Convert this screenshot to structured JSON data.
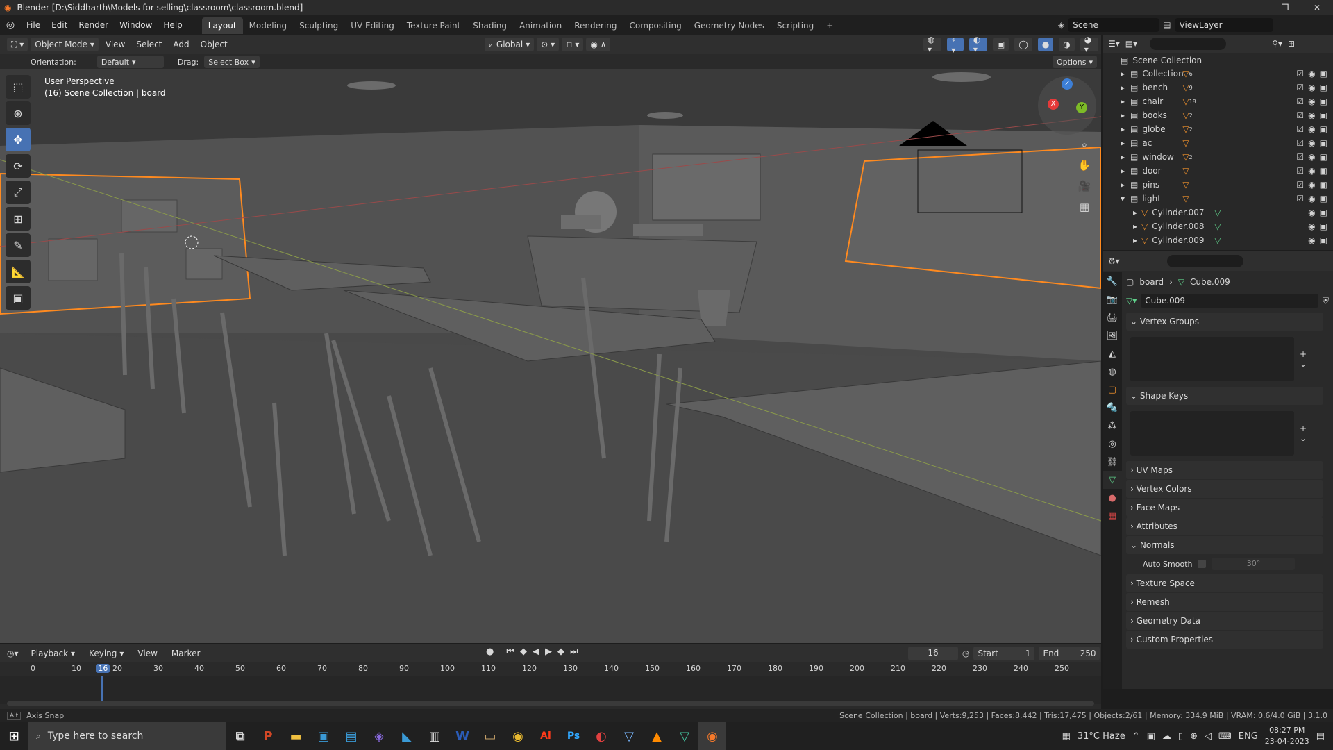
{
  "window": {
    "title": "Blender [D:\\Siddharth\\Models for selling\\classroom\\classroom.blend]",
    "min": "—",
    "restore": "❐",
    "close": "✕"
  },
  "menus": [
    "File",
    "Edit",
    "Render",
    "Window",
    "Help"
  ],
  "workspaces": [
    "Layout",
    "Modeling",
    "Sculpting",
    "UV Editing",
    "Texture Paint",
    "Shading",
    "Animation",
    "Rendering",
    "Compositing",
    "Geometry Nodes",
    "Scripting",
    "+"
  ],
  "scene": {
    "name": "Scene",
    "view_layer": "ViewLayer"
  },
  "header": {
    "mode": "Object Mode",
    "view": "View",
    "select": "Select",
    "add": "Add",
    "object": "Object",
    "transform": "Global"
  },
  "subheader": {
    "orientation_label": "Orientation:",
    "orientation": "Default",
    "drag_label": "Drag:",
    "drag": "Select Box",
    "options": "Options"
  },
  "viewport": {
    "perspective": "User Perspective",
    "collection_info": "(16) Scene Collection | board"
  },
  "outliner": {
    "root": "Scene Collection",
    "items": [
      {
        "label": "Collection",
        "count": "6",
        "expanded": false
      },
      {
        "label": "bench",
        "count": "9",
        "expanded": false
      },
      {
        "label": "chair",
        "count": "18",
        "expanded": false
      },
      {
        "label": "books",
        "count": "2",
        "expanded": false
      },
      {
        "label": "globe",
        "count": "2",
        "expanded": false
      },
      {
        "label": "ac",
        "count": "",
        "expanded": false
      },
      {
        "label": "window",
        "count": "2",
        "expanded": false
      },
      {
        "label": "door",
        "count": "",
        "expanded": false
      },
      {
        "label": "pins",
        "count": "",
        "expanded": false
      },
      {
        "label": "light",
        "count": "",
        "expanded": true
      }
    ],
    "children": [
      "Cylinder.007",
      "Cylinder.008",
      "Cylinder.009"
    ]
  },
  "properties": {
    "breadcrumb_object": "board",
    "breadcrumb_mesh": "Cube.009",
    "mesh_name": "Cube.009",
    "panels_open": [
      "Vertex Groups",
      "Shape Keys"
    ],
    "panels_closed": [
      "UV Maps",
      "Vertex Colors",
      "Face Maps",
      "Attributes"
    ],
    "normals": "Normals",
    "auto_smooth": "Auto Smooth",
    "angle": "30°",
    "panels_closed2": [
      "Texture Space",
      "Remesh",
      "Geometry Data",
      "Custom Properties"
    ]
  },
  "timeline": {
    "menus": [
      "Playback",
      "Keying",
      "View",
      "Marker"
    ],
    "current_frame": "16",
    "start_label": "Start",
    "start": "1",
    "end_label": "End",
    "end": "250",
    "ticks": [
      "0",
      "10",
      "16",
      "20",
      "30",
      "40",
      "50",
      "60",
      "70",
      "80",
      "90",
      "100",
      "110",
      "120",
      "130",
      "140",
      "150",
      "160",
      "170",
      "180",
      "190",
      "200",
      "210",
      "220",
      "230",
      "240",
      "250"
    ]
  },
  "status": {
    "left": "Axis Snap",
    "right": "Scene Collection | board | Verts:9,253 | Faces:8,442 | Tris:17,475 | Objects:2/61 | Memory: 334.9 MiB | VRAM: 0.6/4.0 GiB | 3.1.0"
  },
  "taskbar": {
    "search_placeholder": "Type here to search",
    "weather": "31°C  Haze",
    "lang": "ENG",
    "time": "08:27 PM",
    "date": "23-04-2023"
  },
  "colors": {
    "accent": "#4772b3",
    "selection": "#ff8a1f",
    "header": "#2f2f2f"
  }
}
